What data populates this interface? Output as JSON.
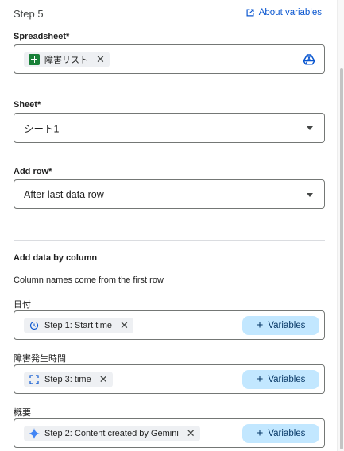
{
  "header": {
    "step_title": "Step 5",
    "about_label": "About variables"
  },
  "spreadsheet": {
    "label": "Spreadsheet*",
    "file_name": "障害リスト"
  },
  "sheet": {
    "label": "Sheet*",
    "value": "シート1"
  },
  "add_row": {
    "label": "Add row*",
    "value": "After last data row"
  },
  "column_section": {
    "title": "Add data by column",
    "helper": "Column names come from the first row",
    "fields": [
      {
        "label": "日付",
        "chip_icon": "timer-icon",
        "chip_text": "Step 1: Start time",
        "button_label": "Variables"
      },
      {
        "label": "障害発生時間",
        "chip_icon": "time-frame-icon",
        "chip_text": "Step 3: time",
        "button_label": "Variables"
      },
      {
        "label": "概要",
        "chip_icon": "gemini-sparkle-icon",
        "chip_text": "Step 2: Content created by Gemini",
        "button_label": "Variables"
      }
    ]
  },
  "colors": {
    "accent": "#0b57d0",
    "variables_button": "#c2e7ff",
    "sheets_green": "#188038",
    "gemini_blue": "#4285f4"
  }
}
